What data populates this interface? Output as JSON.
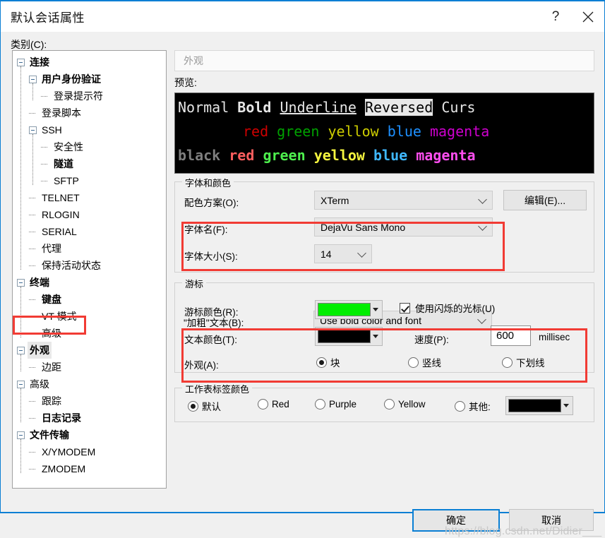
{
  "window": {
    "title": "默认会话属性",
    "help_label": "?",
    "close_label": "✕"
  },
  "category": {
    "label": "类别(C):",
    "tree": [
      {
        "label": "连接",
        "depth": 0,
        "type": "expanded",
        "bold": true,
        "selected": false
      },
      {
        "label": "用户身份验证",
        "depth": 1,
        "type": "expanded",
        "bold": true,
        "selected": false
      },
      {
        "label": "登录提示符",
        "depth": 2,
        "type": "leaf",
        "bold": false,
        "selected": false
      },
      {
        "label": "登录脚本",
        "depth": 1,
        "type": "leaf",
        "bold": false,
        "selected": false
      },
      {
        "label": "SSH",
        "depth": 1,
        "type": "expanded",
        "bold": false,
        "selected": false
      },
      {
        "label": "安全性",
        "depth": 2,
        "type": "leaf",
        "bold": false,
        "selected": false
      },
      {
        "label": "隧道",
        "depth": 2,
        "type": "leaf",
        "bold": true,
        "selected": false
      },
      {
        "label": "SFTP",
        "depth": 2,
        "type": "leaf",
        "bold": false,
        "selected": false
      },
      {
        "label": "TELNET",
        "depth": 1,
        "type": "leaf",
        "bold": false,
        "selected": false
      },
      {
        "label": "RLOGIN",
        "depth": 1,
        "type": "leaf",
        "bold": false,
        "selected": false
      },
      {
        "label": "SERIAL",
        "depth": 1,
        "type": "leaf",
        "bold": false,
        "selected": false
      },
      {
        "label": "代理",
        "depth": 1,
        "type": "leaf",
        "bold": false,
        "selected": false
      },
      {
        "label": "保持活动状态",
        "depth": 1,
        "type": "leaf",
        "bold": false,
        "selected": false
      },
      {
        "label": "终端",
        "depth": 0,
        "type": "expanded",
        "bold": true,
        "selected": false
      },
      {
        "label": "键盘",
        "depth": 1,
        "type": "leaf",
        "bold": true,
        "selected": false
      },
      {
        "label": "VT 模式",
        "depth": 1,
        "type": "leaf",
        "bold": false,
        "selected": false
      },
      {
        "label": "高级",
        "depth": 1,
        "type": "leaf",
        "bold": false,
        "selected": false
      },
      {
        "label": "外观",
        "depth": 0,
        "type": "expanded",
        "bold": true,
        "selected": true
      },
      {
        "label": "边距",
        "depth": 1,
        "type": "leaf",
        "bold": false,
        "selected": false
      },
      {
        "label": "高级",
        "depth": 0,
        "type": "expanded",
        "bold": false,
        "selected": false
      },
      {
        "label": "跟踪",
        "depth": 1,
        "type": "leaf",
        "bold": false,
        "selected": false
      },
      {
        "label": "日志记录",
        "depth": 1,
        "type": "leaf",
        "bold": true,
        "selected": false
      },
      {
        "label": "文件传输",
        "depth": 0,
        "type": "expanded",
        "bold": true,
        "selected": false
      },
      {
        "label": "X/YMODEM",
        "depth": 1,
        "type": "leaf",
        "bold": false,
        "selected": false
      },
      {
        "label": "ZMODEM",
        "depth": 1,
        "type": "leaf",
        "bold": false,
        "selected": false
      }
    ]
  },
  "pane": {
    "header_title": "外观",
    "preview_label": "预览:"
  },
  "preview": {
    "background": "#000000",
    "row1": {
      "normal": "Normal",
      "bold": "Bold",
      "underline": "Underline",
      "reversed": "Reversed",
      "cursor": "Curs"
    },
    "row2": {
      "red": "red",
      "green": "green",
      "yellow": "yellow",
      "blue": "blue",
      "magenta": "magenta"
    },
    "row3": {
      "black": "black",
      "red": "red",
      "green": "green",
      "yellow": "yellow",
      "blue": "blue",
      "magenta": "magenta"
    },
    "colors": {
      "normal_fg": "#e6e6e6",
      "dim_red": "#cd0000",
      "dim_green": "#00a000",
      "dim_yellow": "#cdcd00",
      "dim_blue": "#1e90ff",
      "dim_magenta": "#cd00cd",
      "bright_black": "#7f7f7f",
      "bright_red": "#ff5f5f",
      "bright_green": "#4ef04e",
      "bright_yellow": "#f5f53f",
      "bright_blue": "#3fb8ff",
      "bright_magenta": "#ff4ef0",
      "reversed_bg": "#e8e8e8",
      "reversed_fg": "#000000"
    }
  },
  "font_group": {
    "title": "字体和颜色",
    "scheme_label": "配色方案(O):",
    "scheme_value": "XTerm",
    "edit_button": "编辑(E)...",
    "fontname_label": "字体名(F):",
    "fontname_value": "DejaVu Sans Mono",
    "fontsize_label": "字体大小(S):",
    "fontsize_value": "14",
    "boldtext_label": "\"加粗\"文本(B):",
    "boldtext_value": "Use bold color and font"
  },
  "cursor_group": {
    "title": "游标",
    "cursor_color_label": "游标颜色(R):",
    "cursor_color_value": "#00ee00",
    "text_color_label": "文本颜色(T):",
    "text_color_value": "#000000",
    "blink_label": "使用闪烁的光标(U)",
    "blink_checked": true,
    "speed_label": "速度(P):",
    "speed_value": "600",
    "speed_unit": "millisec",
    "appearance_label": "外观(A):",
    "appearance_options": [
      {
        "label": "块",
        "selected": true
      },
      {
        "label": "竖线",
        "selected": false
      },
      {
        "label": "下划线",
        "selected": false
      }
    ]
  },
  "tab_group": {
    "title": "工作表标签颜色",
    "options": [
      {
        "label": "默认",
        "selected": true
      },
      {
        "label": "Red",
        "selected": false
      },
      {
        "label": "Purple",
        "selected": false
      },
      {
        "label": "Yellow",
        "selected": false
      },
      {
        "label": "其他:",
        "selected": false
      }
    ],
    "other_color_value": "#000000"
  },
  "buttons": {
    "ok": "确定",
    "cancel": "取消"
  },
  "watermark": "https://blog.csdn.net/Didier___"
}
